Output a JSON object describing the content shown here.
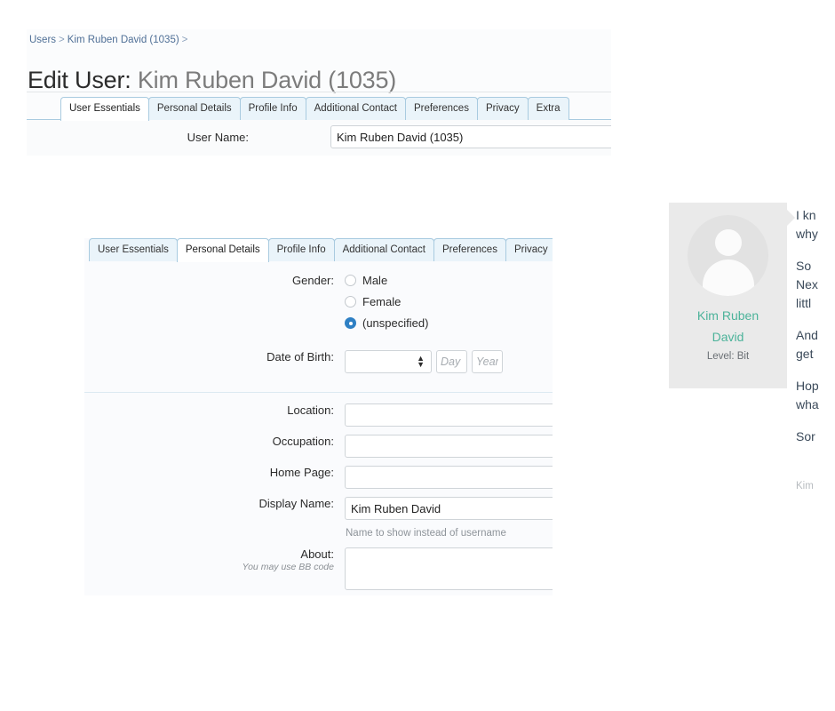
{
  "breadcrumb": {
    "items": [
      "Users",
      "Kim Ruben David (1035)"
    ],
    "separator": ">"
  },
  "page": {
    "title_prefix": "Edit User:",
    "title_subject": "Kim Ruben David (1035)"
  },
  "tabs": {
    "labels": [
      "User Essentials",
      "Personal Details",
      "Profile Info",
      "Additional Contact",
      "Preferences",
      "Privacy",
      "Extra"
    ],
    "top_active": "User Essentials",
    "mid_active": "Personal Details"
  },
  "top_form": {
    "username_label": "User Name:",
    "username_value": "Kim Ruben David (1035)"
  },
  "personal_details": {
    "gender_label": "Gender:",
    "gender_options": [
      "Male",
      "Female",
      "(unspecified)"
    ],
    "gender_selected": "(unspecified)",
    "dob_label": "Date of Birth:",
    "dob_month_value": "",
    "dob_day_placeholder": "Day",
    "dob_day_value": "",
    "dob_year_placeholder": "Year",
    "dob_year_value": "",
    "location_label": "Location:",
    "location_value": "",
    "occupation_label": "Occupation:",
    "occupation_value": "",
    "homepage_label": "Home Page:",
    "homepage_value": "",
    "display_name_label": "Display Name:",
    "display_name_value": "Kim Ruben David",
    "display_name_hint": "Name to show instead of username",
    "about_label": "About:",
    "about_sublabel": "You may use BB code",
    "about_value": ""
  },
  "profile_card": {
    "name_line1": "Kim Ruben",
    "name_line2": "David",
    "level": "Level: Bit"
  },
  "post": {
    "paragraphs": [
      "I kn\nwhy",
      "So \nNex\nlittl",
      "And\nget",
      "Hop\nwha",
      "Sor"
    ],
    "lines": [
      "I kn",
      "why",
      "So ",
      "Nex",
      "littl",
      "And",
      "get",
      "Hop",
      "wha",
      "Sor"
    ],
    "signature": "Kim"
  },
  "colors": {
    "accent_blue": "#2f80c4",
    "tab_border": "#a9cbe0",
    "tab_inactive_bg": "#eaf4fa",
    "breadcrumb": "#4f6f96",
    "avatar_name": "#4cb39a",
    "card_bg": "#eaeaea"
  }
}
